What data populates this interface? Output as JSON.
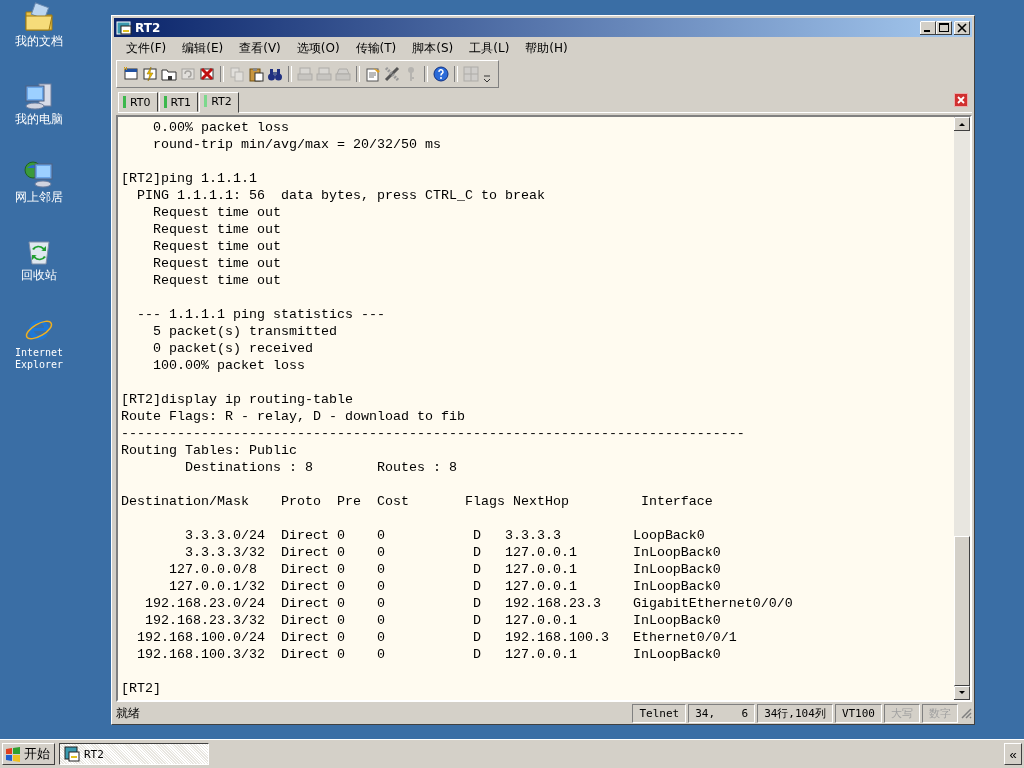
{
  "desktop_icons": [
    {
      "kind": "documents",
      "label": "我的文档"
    },
    {
      "kind": "computer",
      "label": "我的电脑"
    },
    {
      "kind": "network",
      "label": "网上邻居"
    },
    {
      "kind": "recycle",
      "label": "回收站"
    },
    {
      "kind": "browser",
      "label": "Internet Explorer"
    }
  ],
  "window": {
    "title": "RT2",
    "menu": [
      "文件(F)",
      "编辑(E)",
      "查看(V)",
      "选项(O)",
      "传输(T)",
      "脚本(S)",
      "工具(L)",
      "帮助(H)"
    ],
    "toolbar": [
      {
        "kind": "window",
        "disabled": false
      },
      {
        "kind": "lightning",
        "disabled": false
      },
      {
        "kind": "folder",
        "disabled": false
      },
      {
        "kind": "refresh",
        "disabled": true
      },
      {
        "kind": "xmark",
        "disabled": false
      },
      {
        "kind": "separator"
      },
      {
        "kind": "copy",
        "disabled": true
      },
      {
        "kind": "paste",
        "disabled": false
      },
      {
        "kind": "find",
        "disabled": false
      },
      {
        "kind": "separator"
      },
      {
        "kind": "print",
        "disabled": true
      },
      {
        "kind": "print",
        "disabled": true
      },
      {
        "kind": "printer",
        "disabled": true
      },
      {
        "kind": "separator"
      },
      {
        "kind": "document",
        "disabled": false
      },
      {
        "kind": "tools",
        "disabled": false
      },
      {
        "kind": "key",
        "disabled": true
      },
      {
        "kind": "separator"
      },
      {
        "kind": "help",
        "disabled": false
      },
      {
        "kind": "separator"
      },
      {
        "kind": "grid",
        "disabled": true
      },
      {
        "kind": "overflow",
        "disabled": false
      }
    ],
    "tabs": [
      {
        "label": "RT0",
        "selected": false
      },
      {
        "label": "RT1",
        "selected": false
      },
      {
        "label": "RT2",
        "selected": true
      }
    ],
    "terminal": {
      "blocks": [
        [
          "    0.00% packet loss",
          "    round-trip min/avg/max = 20/32/50 ms"
        ],
        [
          "[RT2]ping 1.1.1.1",
          "  PING 1.1.1.1: 56  data bytes, press CTRL_C to break",
          "    Request time out",
          "    Request time out",
          "    Request time out",
          "    Request time out",
          "    Request time out"
        ],
        [
          "  --- 1.1.1.1 ping statistics ---",
          "    5 packet(s) transmitted",
          "    0 packet(s) received",
          "    100.00% packet loss"
        ],
        [
          "[RT2]display ip routing-table",
          "Route Flags: R - relay, D - download to fib",
          "------------------------------------------------------------------------------",
          "Routing Tables: Public",
          "        Destinations : 8        Routes : 8"
        ],
        [
          "Destination/Mask    Proto  Pre  Cost       Flags NextHop         Interface"
        ],
        [
          "        3.3.3.0/24  Direct 0    0           D   3.3.3.3         LoopBack0",
          "        3.3.3.3/32  Direct 0    0           D   127.0.0.1       InLoopBack0",
          "      127.0.0.0/8   Direct 0    0           D   127.0.0.1       InLoopBack0",
          "      127.0.0.1/32  Direct 0    0           D   127.0.0.1       InLoopBack0",
          "   192.168.23.0/24  Direct 0    0           D   192.168.23.3    GigabitEthernet0/0/0",
          "   192.168.23.3/32  Direct 0    0           D   127.0.0.1       InLoopBack0",
          "  192.168.100.0/24  Direct 0    0           D   192.168.100.3   Ethernet0/0/1",
          "  192.168.100.3/32  Direct 0    0           D   127.0.0.1       InLoopBack0"
        ],
        [
          "[RT2]"
        ]
      ]
    },
    "status_bar": {
      "message": "就绪",
      "fields": [
        {
          "text": "Telnet",
          "disabled": false
        },
        {
          "text": "34,    6",
          "disabled": false
        },
        {
          "text": "34行,104列",
          "disabled": false
        },
        {
          "text": "VT100",
          "disabled": false
        },
        {
          "text": "大写",
          "disabled": true
        },
        {
          "text": "数字",
          "disabled": true
        }
      ]
    }
  },
  "taskbar": {
    "start": "开始",
    "tasks": [
      {
        "label": "RT2",
        "selected": true
      }
    ],
    "tray_button": "«"
  }
}
